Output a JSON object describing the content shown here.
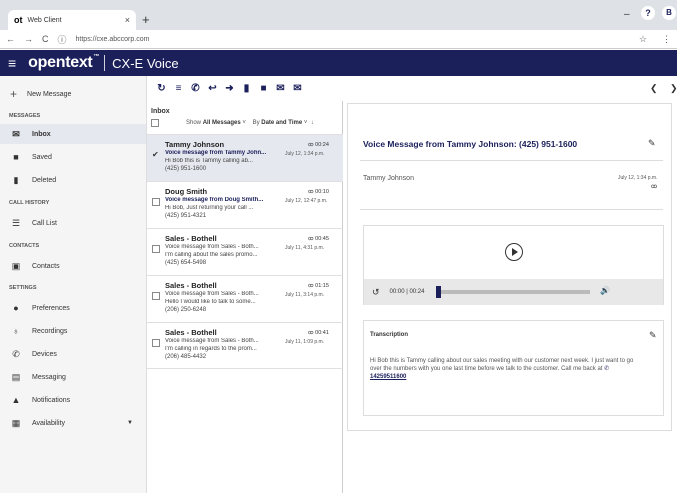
{
  "browser": {
    "tab_icon": "ot",
    "tab_title": "Web Client",
    "tab_close": "×",
    "new_tab": "+",
    "url": "https://cxe.abccorp.com",
    "minimize": "–",
    "maximize": "□",
    "close": "×"
  },
  "header": {
    "logo": "opentext",
    "trademark": "™",
    "product": "CX-E Voice",
    "help_label": "?",
    "user_initial": "B"
  },
  "sidebar": {
    "new_message": "New Message",
    "sections": {
      "messages": "MESSAGES",
      "call_history": "CALL HISTORY",
      "contacts": "CONTACTS",
      "settings": "SETTINGS"
    },
    "items": [
      {
        "label": "Inbox",
        "icon": "inbox-icon"
      },
      {
        "label": "Saved",
        "icon": "save-icon"
      },
      {
        "label": "Deleted",
        "icon": "trash-icon"
      },
      {
        "label": "Call List",
        "icon": "list-icon"
      },
      {
        "label": "Contacts",
        "icon": "contacts-icon"
      },
      {
        "label": "Preferences",
        "icon": "person-icon"
      },
      {
        "label": "Recordings",
        "icon": "microphone-icon"
      },
      {
        "label": "Devices",
        "icon": "phone-icon"
      },
      {
        "label": "Messaging",
        "icon": "chat-icon"
      },
      {
        "label": "Notifications",
        "icon": "bell-icon"
      },
      {
        "label": "Availability",
        "icon": "calendar-icon"
      }
    ]
  },
  "list": {
    "title": "Inbox",
    "filter_prefix": "Show",
    "filter_value": "All Messages",
    "sort_prefix": "By",
    "sort_value": "Date and Time",
    "messages": [
      {
        "name": "Tammy Johnson",
        "duration": "00:24",
        "subject": "Voice message from Tammy John...",
        "date": "July 12, 1:34 p.m.",
        "body": "Hi Bob this is Tammy calling ab...",
        "phone": "(425) 951-1600",
        "selected": true
      },
      {
        "name": "Doug Smith",
        "duration": "00:10",
        "subject": "Voice message from Doug Smith...",
        "date": "July 12, 12:47 p.m.",
        "body": "Hi Bob, Just returning your call ...",
        "phone": "(425) 951-4321",
        "selected": false
      },
      {
        "name": "Sales - Bothell",
        "duration": "00:45",
        "subject": "Voice message from Sales - Both...",
        "date": "July 11, 4:31 p.m.",
        "body": "I'm calling about the sales promo...",
        "phone": "(425) 654-5498",
        "selected": false
      },
      {
        "name": "Sales - Bothell",
        "duration": "01:15",
        "subject": "Voice message from Sales - Both...",
        "date": "July 11, 3:14 p.m.",
        "body": "Hello I would like to talk to some...",
        "phone": "(206) 250-6248",
        "selected": false
      },
      {
        "name": "Sales - Bothell",
        "duration": "00:41",
        "subject": "Voice message from Sales - Both...",
        "date": "July 11, 1:09 p.m.",
        "body": "I'm calling in regards to the prom...",
        "phone": "(206) 485-4432",
        "selected": false
      }
    ]
  },
  "detail": {
    "title": "Voice Message from Tammy Johnson: (425) 951-1600",
    "sender": "Tammy Johnson",
    "date": "July 12, 1:34 p.m.",
    "player": {
      "time": "00:00 | 00:24",
      "progress": 0.0
    },
    "transcription_label": "Transcription",
    "transcription_text": "Hi Bob this is Tammy calling about our sales meeting with our customer next week. I just want to go over the numbers with you one last time before we talk to the customer. Call me back at",
    "transcription_phone": "14259511600"
  },
  "colors": {
    "brand": "#1b1f5a",
    "selected_bg": "#e6e8ef"
  }
}
